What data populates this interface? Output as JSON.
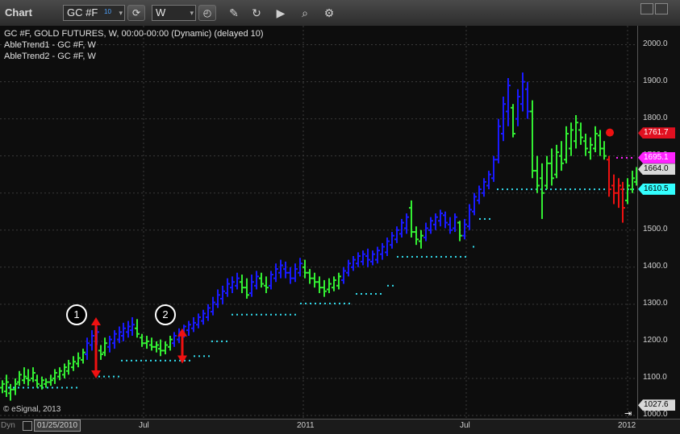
{
  "toolbar": {
    "title": "Chart",
    "symbol": "GC #F",
    "symbol_superscript": "10",
    "interval": "W",
    "icons": [
      "link-icon",
      "clock-icon",
      "pencil-icon",
      "refresh-icon",
      "play-icon",
      "search-icon",
      "settings-icon"
    ]
  },
  "info": {
    "line1": "GC #F, GOLD FUTURES, W, 00:00-00:00 (Dynamic) (delayed 10)",
    "line2": "AbleTrend1 - GC #F, W",
    "line3": "AbleTrend2 - GC #F, W"
  },
  "credit": "© eSignal, 2013",
  "annotations": {
    "marker1": "1",
    "marker2": "2"
  },
  "price_axis": {
    "labels": [
      "2000.0",
      "1900.0",
      "1800.0",
      "1700.0",
      "1600.0",
      "1500.0",
      "1400.0",
      "1300.0",
      "1200.0",
      "1100.0",
      "1000.0"
    ],
    "tags": [
      {
        "text": "1761.7",
        "bg": "#e01020",
        "fg": "#ffffff"
      },
      {
        "text": "1695.1",
        "bg": "#ff22ff",
        "fg": "#ffffff"
      },
      {
        "text": "1664.0",
        "bg": "#d8d8d8",
        "fg": "#000000"
      },
      {
        "text": "1610.5",
        "bg": "#33ffff",
        "fg": "#000000"
      },
      {
        "text": "1027.6",
        "bg": "#d8d8d8",
        "fg": "#000000"
      }
    ]
  },
  "time_axis": {
    "start_date": "01/25/2010",
    "labels": [
      "Jul",
      "2011",
      "Jul",
      "2012"
    ],
    "prefix": "Dyn"
  },
  "colors": {
    "up": "#33ee33",
    "down": "#1a1aff",
    "red": "#ee1111",
    "stop": "#33ddee",
    "magenta": "#ff22ff"
  },
  "chart_data": {
    "type": "bar",
    "title": "GC #F, GOLD FUTURES, W",
    "ylim": [
      1000,
      2025
    ],
    "series": [
      {
        "name": "AbleTrend1 - GC #F, W",
        "values": [
          1090,
          1070,
          1115,
          1105,
          1160,
          1250,
          1320,
          1290,
          1230,
          1370,
          1390,
          1380,
          1510,
          1480,
          1850,
          1620,
          1790,
          1600
        ]
      },
      {
        "name": "AbleTrend2 - GC #F, W",
        "values": [
          1075,
          1105,
          1160,
          1148,
          1200,
          1272,
          1302,
          1328,
          1350,
          1380,
          1428,
          1455,
          1530,
          1610,
          1610,
          1610,
          1695
        ]
      }
    ]
  }
}
